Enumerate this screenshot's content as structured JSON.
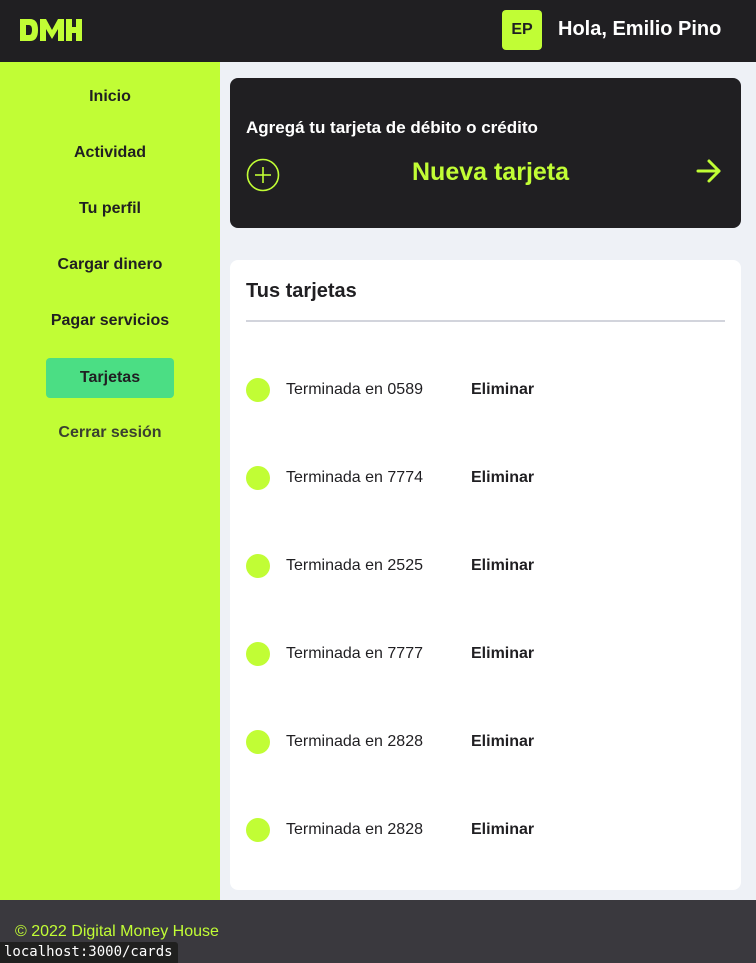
{
  "header": {
    "logo_text": "DMH",
    "avatar_initials": "EP",
    "greeting": "Hola, Emilio Pino"
  },
  "sidebar": {
    "items": [
      {
        "label": "Inicio",
        "active": false
      },
      {
        "label": "Actividad",
        "active": false
      },
      {
        "label": "Tu perfil",
        "active": false
      },
      {
        "label": "Cargar dinero",
        "active": false
      },
      {
        "label": "Pagar servicios",
        "active": false
      },
      {
        "label": "Tarjetas",
        "active": true
      },
      {
        "label": "Cerrar sesión",
        "active": false
      }
    ]
  },
  "add_card": {
    "title": "Agregá tu tarjeta de débito o crédito",
    "action_label": "Nueva tarjeta",
    "left_icon": "plus-circle-icon",
    "right_icon": "arrow-right-icon"
  },
  "cards": {
    "title": "Tus tarjetas",
    "items": [
      {
        "label": "Terminada en 0589",
        "action": "Eliminar"
      },
      {
        "label": "Terminada en 7774",
        "action": "Eliminar"
      },
      {
        "label": "Terminada en 2525",
        "action": "Eliminar"
      },
      {
        "label": "Terminada en 7777",
        "action": "Eliminar"
      },
      {
        "label": "Terminada en 2828",
        "action": "Eliminar"
      },
      {
        "label": "Terminada en 2828",
        "action": "Eliminar"
      }
    ]
  },
  "footer": {
    "copyright": "© 2022 Digital Money House"
  },
  "status_bar": {
    "url": "localhost:3000/cards"
  },
  "colors": {
    "accent": "#c1fd35",
    "dark": "#201f22",
    "active_nav": "#4bde84",
    "footer": "#3a393e",
    "background": "#eef1f6"
  }
}
